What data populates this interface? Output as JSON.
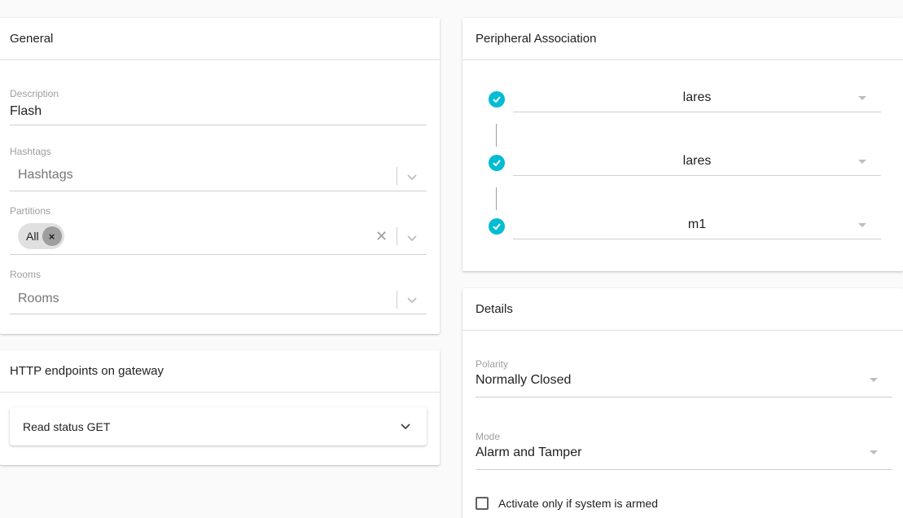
{
  "general": {
    "title": "General",
    "description": {
      "label": "Description",
      "value": "Flash"
    },
    "hashtags": {
      "label": "Hashtags",
      "placeholder": "Hashtags"
    },
    "partitions": {
      "label": "Partitions",
      "chip": "All",
      "chip_remove_icon": "close-icon",
      "clear_icon": "close-icon"
    },
    "rooms": {
      "label": "Rooms",
      "placeholder": "Rooms"
    }
  },
  "http": {
    "title": "HTTP endpoints on gateway",
    "endpoints": [
      {
        "label": "Read status GET"
      }
    ]
  },
  "peripheral": {
    "title": "Peripheral Association",
    "accent_color": "#00bcd4",
    "items": [
      {
        "value": "lares",
        "icon": "check-circle-icon"
      },
      {
        "value": "lares",
        "icon": "check-circle-icon"
      },
      {
        "value": "m1",
        "icon": "check-circle-icon"
      }
    ]
  },
  "details": {
    "title": "Details",
    "polarity": {
      "label": "Polarity",
      "value": "Normally Closed"
    },
    "mode": {
      "label": "Mode",
      "value": "Alarm and Tamper"
    },
    "armed_checkbox": {
      "label": "Activate only if system is armed",
      "checked": false
    }
  }
}
